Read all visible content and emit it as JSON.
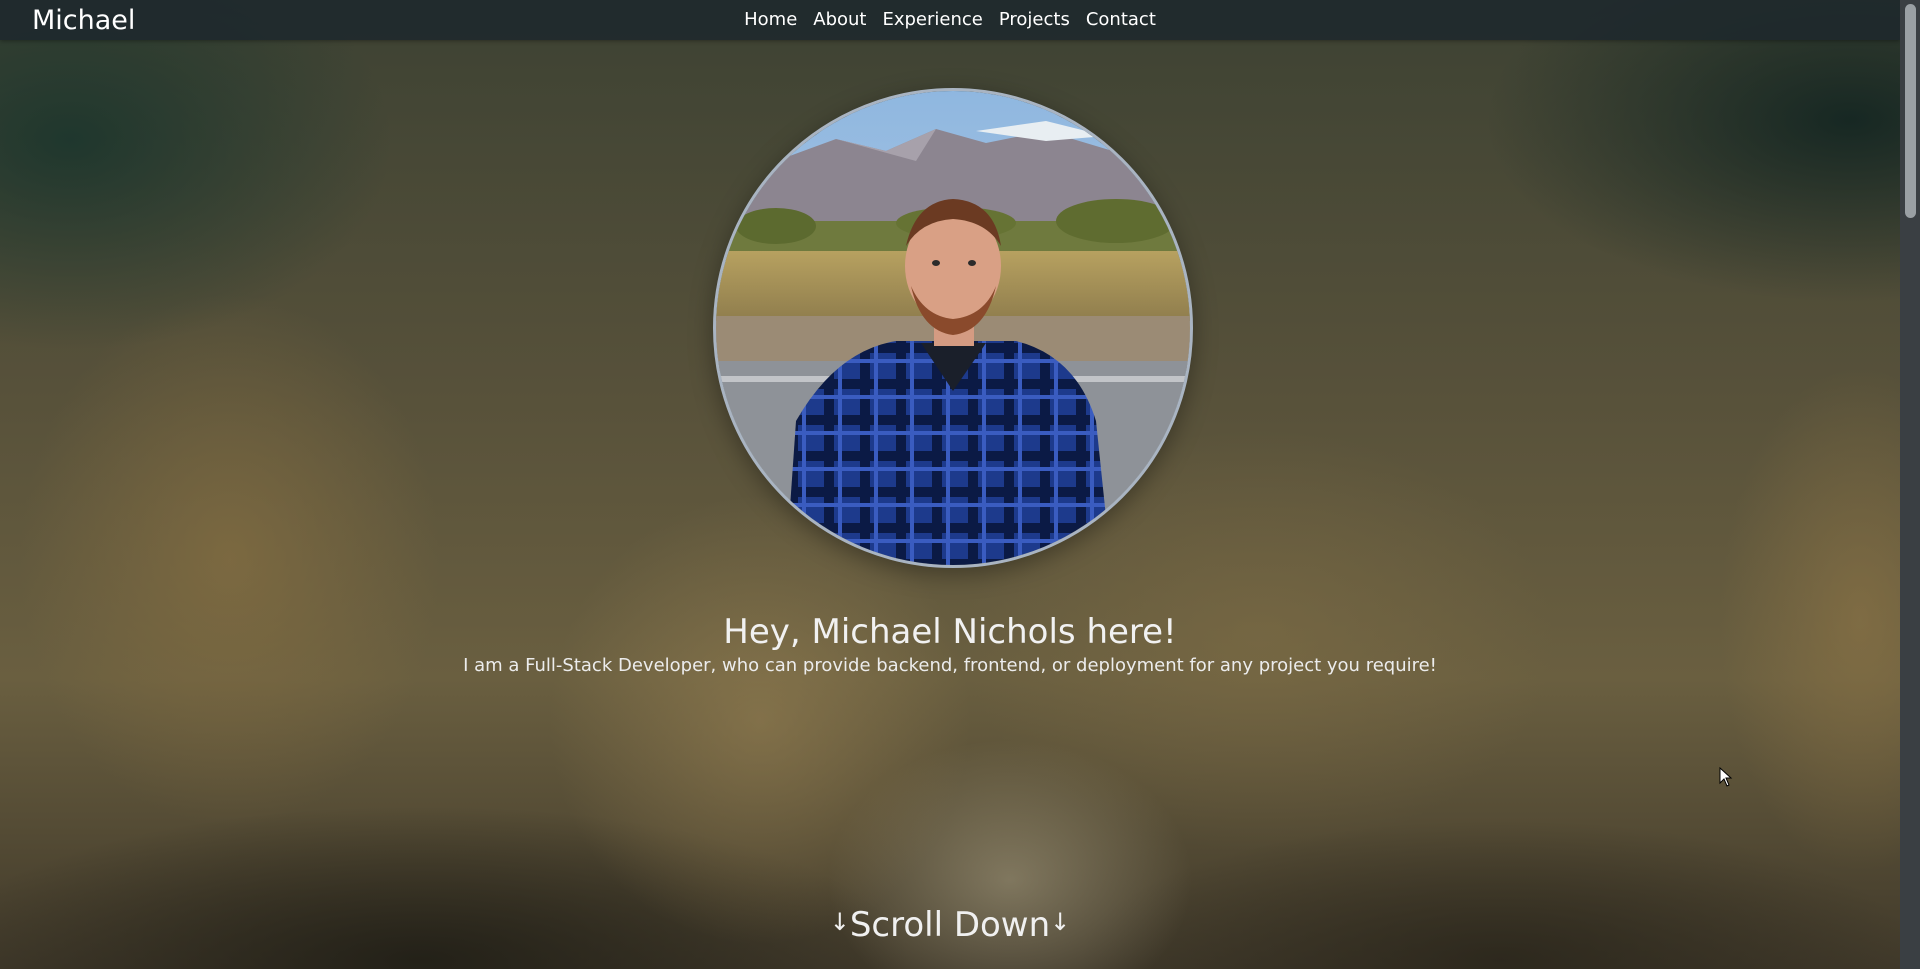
{
  "navbar": {
    "brand": "Michael",
    "links": [
      "Home",
      "About",
      "Experience",
      "Projects",
      "Contact"
    ]
  },
  "hero": {
    "title": "Hey, Michael Nichols here!",
    "subtitle": "I am a Full-Stack Developer, who can provide backend, frontend, or deployment for any project you require!",
    "scroll_label": "Scroll Down",
    "arrow_glyph": "↓"
  },
  "icons": {
    "profile_photo": "profile-photo",
    "scroll_arrow": "arrow-down-icon",
    "cursor": "mouse-pointer-icon"
  },
  "colors": {
    "navbar_bg": "#1e282c",
    "avatar_border": "#a9b4c2",
    "text": "#f1f1f1"
  }
}
